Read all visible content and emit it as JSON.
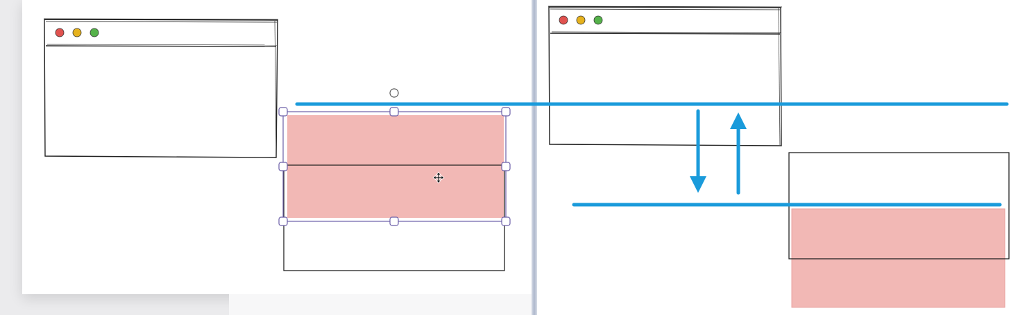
{
  "canvas": {
    "title": ""
  },
  "window_mockup": {
    "traffic_lights": {
      "close_color": "#e0524f",
      "minimize_color": "#e6b21e",
      "maximize_color": "#55b24a"
    }
  },
  "selection": {
    "shape_fill": "#f2b8b5",
    "handle_stroke": "#6b5ea8",
    "move_cursor": "move-cursor-icon"
  },
  "guides": {
    "color": "#1a9bdb",
    "arrows": [
      "arrow-down-icon",
      "arrow-up-icon"
    ]
  }
}
